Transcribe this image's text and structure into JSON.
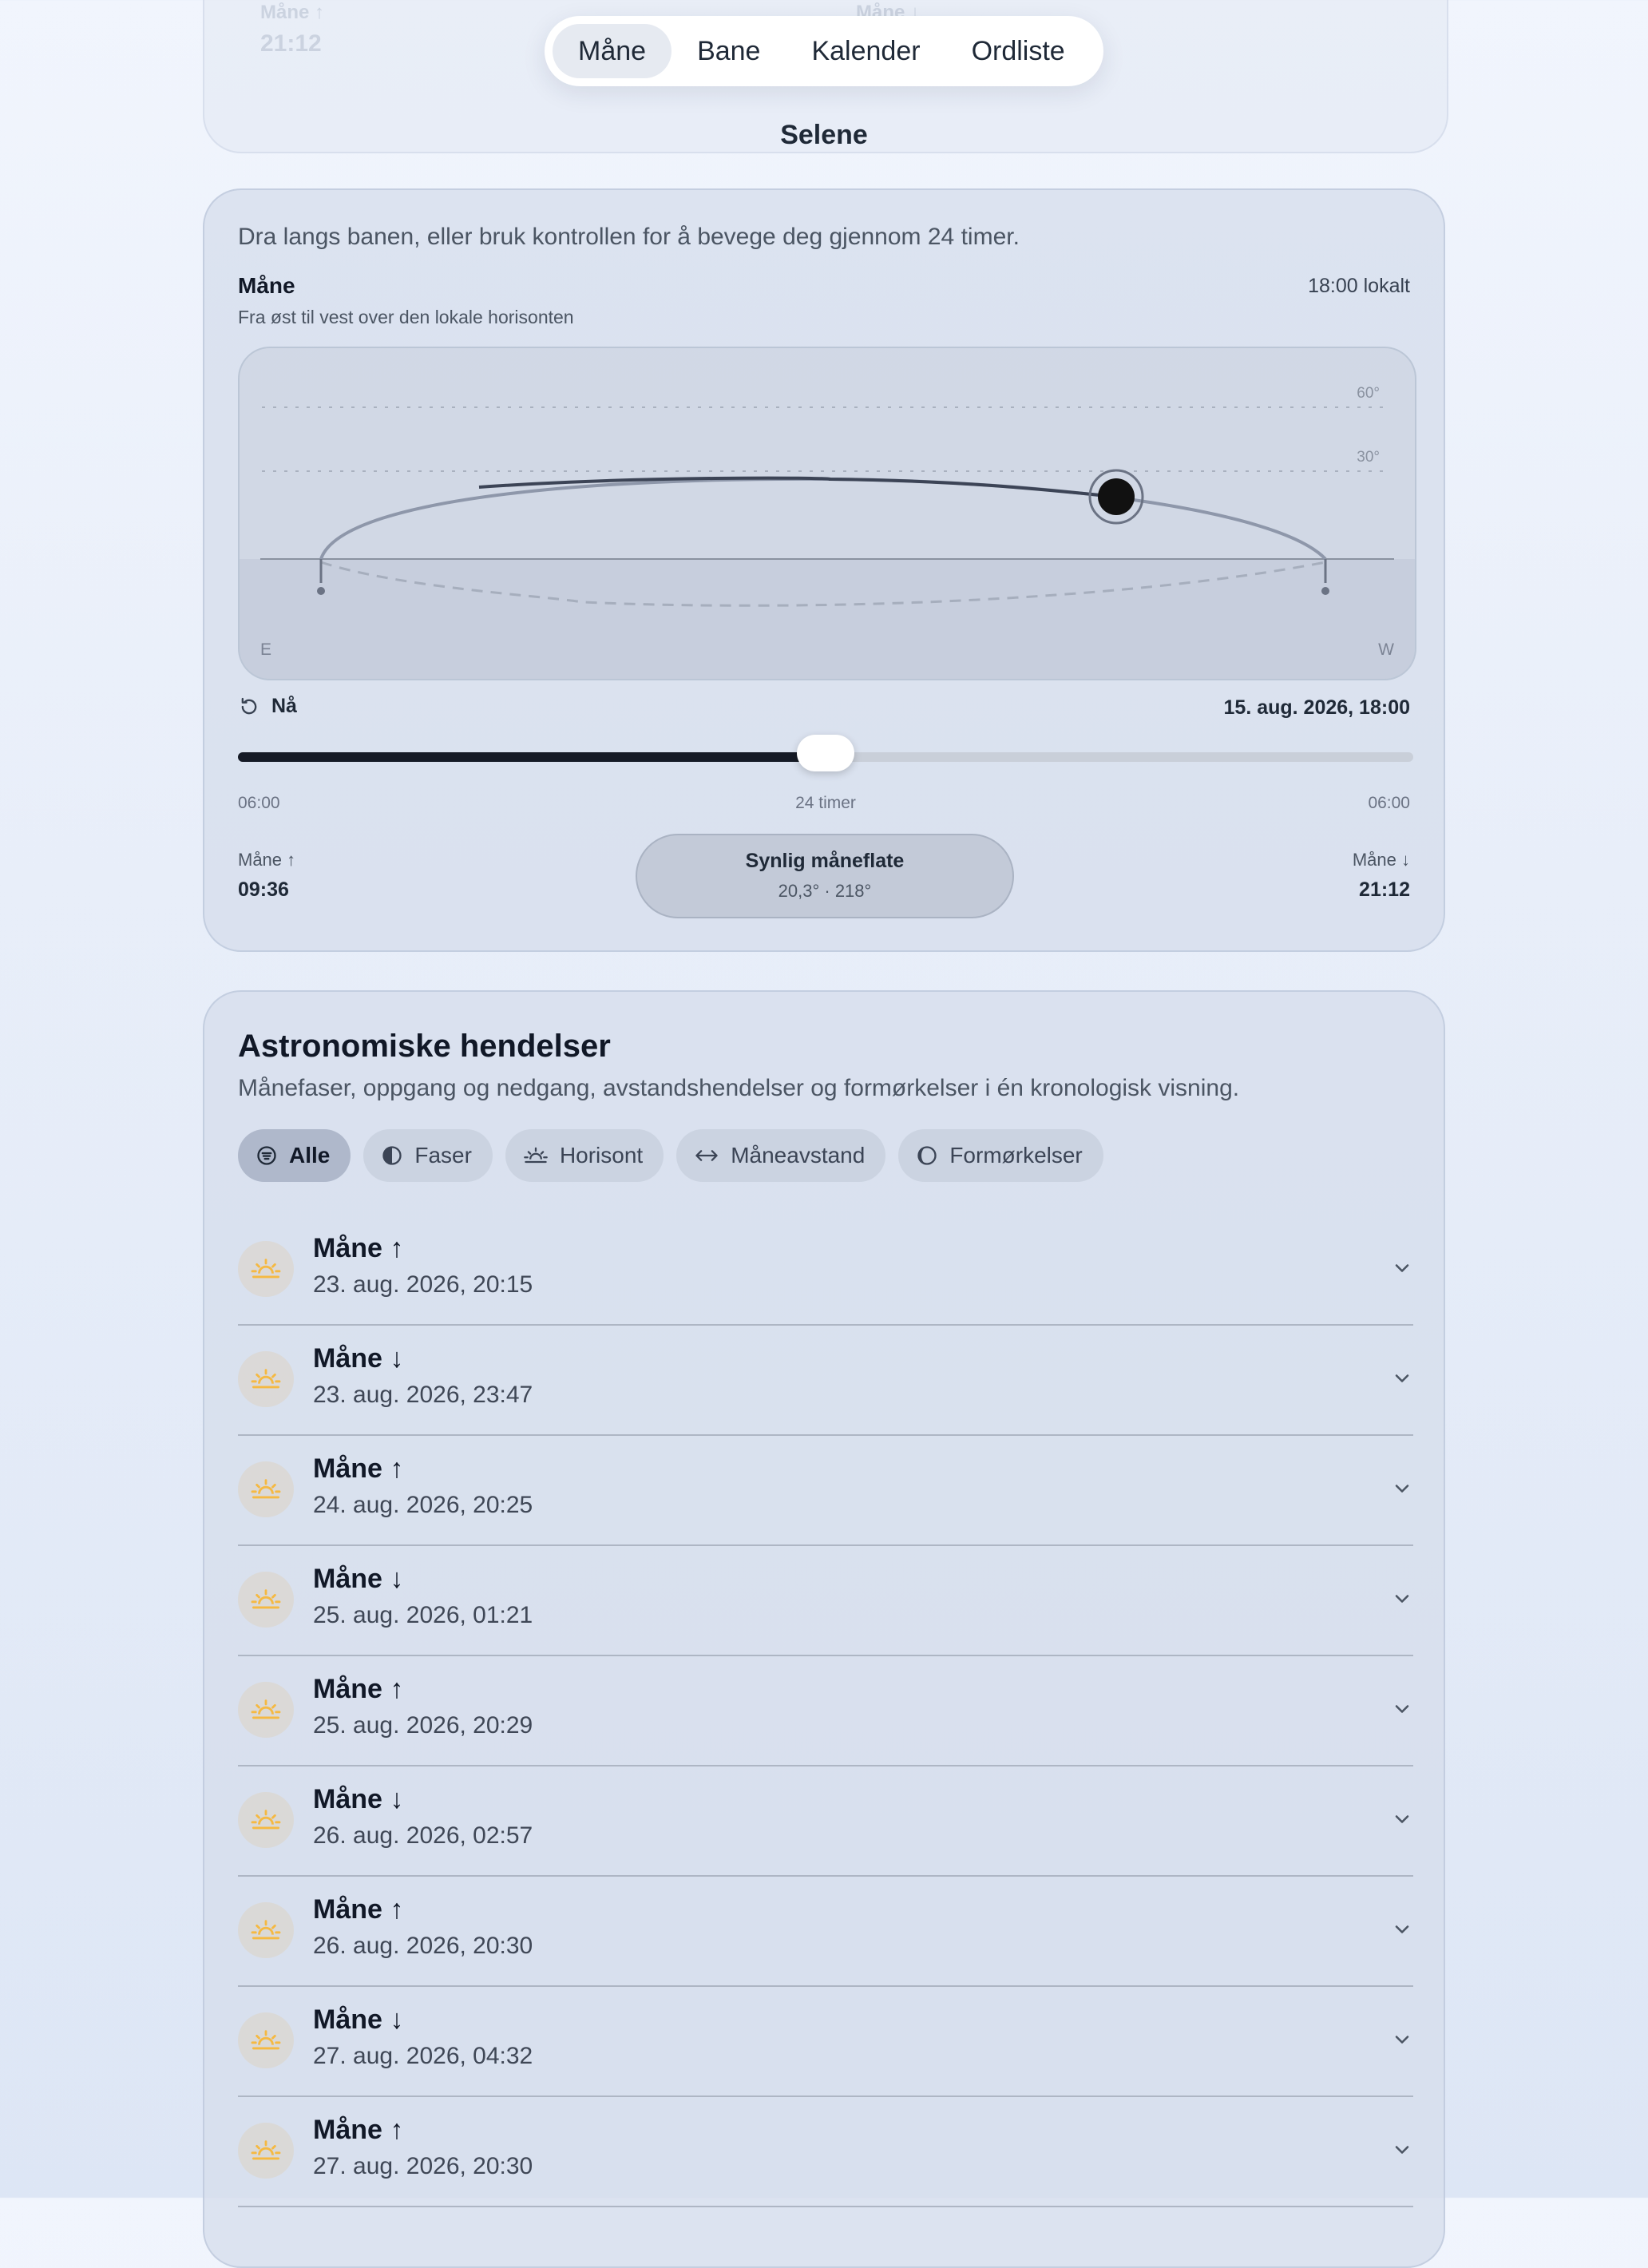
{
  "nav": {
    "tabs": [
      {
        "label": "Måne",
        "active": true
      },
      {
        "label": "Bane",
        "active": false
      },
      {
        "label": "Kalender",
        "active": false
      },
      {
        "label": "Ordliste",
        "active": false
      }
    ]
  },
  "top_card": {
    "left_label": "Måne ↑",
    "left_time": "21:12",
    "right_label": "Måne ↓"
  },
  "app_title": "Selene",
  "path_card": {
    "instruction": "Dra langs banen, eller bruk kontrollen for å bevege deg gjennom 24 timer.",
    "object_title": "Måne",
    "object_subtitle": "Fra øst til vest over den lokale horisonten",
    "local_time": "18:00 lokalt",
    "chart": {
      "grid_labels": [
        "60°",
        "30°"
      ],
      "east_label": "E",
      "west_label": "W"
    },
    "now_label": "Nå",
    "datetime": "15. aug. 2026, 18:00",
    "slider": {
      "value": 0.5,
      "start_label": "06:00",
      "middle_label": "24 timer",
      "end_label": "06:00"
    },
    "rise": {
      "label": "Måne ↑",
      "time": "09:36"
    },
    "set": {
      "label": "Måne ↓",
      "time": "21:12"
    },
    "visible_surface": {
      "title": "Synlig måneflate",
      "value": "20,3° · 218°"
    }
  },
  "events_card": {
    "title": "Astronomiske hendelser",
    "subtitle": "Månefaser, oppgang og nedgang, avstandshendelser og formørkelser i én kronologisk visning.",
    "filters": [
      {
        "label": "Alle",
        "icon": "filter-icon",
        "active": true
      },
      {
        "label": "Faser",
        "icon": "half-moon-icon",
        "active": false
      },
      {
        "label": "Horisont",
        "icon": "sunrise-icon",
        "active": false
      },
      {
        "label": "Måneavstand",
        "icon": "double-arrow-icon",
        "active": false
      },
      {
        "label": "Formørkelser",
        "icon": "eclipse-icon",
        "active": false
      }
    ],
    "events": [
      {
        "title": "Måne ↑",
        "date": "23. aug. 2026, 20:15"
      },
      {
        "title": "Måne ↓",
        "date": "23. aug. 2026, 23:47"
      },
      {
        "title": "Måne ↑",
        "date": "24. aug. 2026, 20:25"
      },
      {
        "title": "Måne ↓",
        "date": "25. aug. 2026, 01:21"
      },
      {
        "title": "Måne ↑",
        "date": "25. aug. 2026, 20:29"
      },
      {
        "title": "Måne ↓",
        "date": "26. aug. 2026, 02:57"
      },
      {
        "title": "Måne ↑",
        "date": "26. aug. 2026, 20:30"
      },
      {
        "title": "Måne ↓",
        "date": "27. aug. 2026, 04:32"
      },
      {
        "title": "Måne ↑",
        "date": "27. aug. 2026, 20:30"
      }
    ]
  },
  "colors": {
    "accent_dark": "#151a26",
    "sun_icon": "#f5b942",
    "card_bg": "#d6deec"
  }
}
